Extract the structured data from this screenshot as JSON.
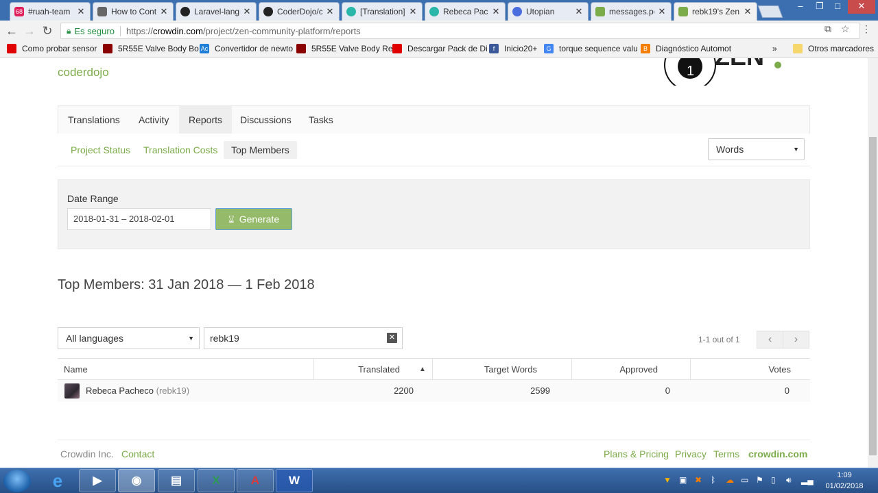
{
  "browser": {
    "tabs": [
      {
        "title": "#ruah-team",
        "fav_color": "#e01e5a",
        "fav_text": "68"
      },
      {
        "title": "How to Conti",
        "fav_color": "#666666",
        "fav_text": ""
      },
      {
        "title": "Laravel-lang",
        "fav_color": "#222222",
        "fav_text": ""
      },
      {
        "title": "CoderDojo/c",
        "fav_color": "#222222",
        "fav_text": ""
      },
      {
        "title": "[Translation]",
        "fav_color": "#2ab7a9",
        "fav_text": ""
      },
      {
        "title": "Rebeca Pach",
        "fav_color": "#2ab7a9",
        "fav_text": ""
      },
      {
        "title": "Utopian",
        "fav_color": "#4a6ee0",
        "fav_text": ""
      },
      {
        "title": "messages.po",
        "fav_color": "#7cab4a",
        "fav_text": ""
      },
      {
        "title": "rebk19's Zen",
        "fav_color": "#7cab4a",
        "fav_text": ""
      }
    ],
    "close_glyph": "✕",
    "security_label": "Es seguro",
    "url_prefix": "https://",
    "url_host": "crowdin.com",
    "url_path": "/project/zen-community-platform/reports",
    "bookmarks": [
      {
        "label": "Como probar sensor",
        "color": "#e00000"
      },
      {
        "label": "5R55E Valve Body Bo",
        "color": "#8b0000"
      },
      {
        "label": "Convertidor de newto",
        "color": "#1e7ed8"
      },
      {
        "label": "5R55E Valve Body Re",
        "color": "#8b0000"
      },
      {
        "label": "Descargar Pack de Di",
        "color": "#e00000"
      },
      {
        "label": "Inicio20+",
        "color": "#3b5998"
      },
      {
        "label": "torque sequence valu",
        "color": "#4285f4"
      },
      {
        "label": "Diagnóstico Automot",
        "color": "#f57d00"
      }
    ],
    "more_bookmarks": "»",
    "other_bookmarks": "Otros marcadores"
  },
  "page": {
    "org_name": "coderdojo",
    "logo_text": "ZEN",
    "logo_number": "1",
    "main_nav": [
      {
        "label": "Translations"
      },
      {
        "label": "Activity"
      },
      {
        "label": "Reports"
      },
      {
        "label": "Discussions"
      },
      {
        "label": "Tasks"
      }
    ],
    "active_main_nav": "Reports",
    "sub_nav": [
      {
        "label": "Project Status"
      },
      {
        "label": "Translation Costs"
      },
      {
        "label": "Top Members"
      }
    ],
    "active_sub_nav": "Top Members",
    "units_select": "Words",
    "date_range": {
      "label": "Date Range",
      "value": "2018-01-31 – 2018-02-01",
      "generate_label": "Generate"
    },
    "heading": "Top Members: 31 Jan 2018 — 1 Feb 2018",
    "filters": {
      "language": "All languages",
      "search_value": "rebk19"
    },
    "pagination": {
      "count_text": "1-1 out of 1",
      "prev": "‹",
      "next": "›"
    },
    "table": {
      "columns": [
        "Name",
        "Translated",
        "Target Words",
        "Approved",
        "Votes"
      ],
      "sort_indicator": "▲",
      "rows": [
        {
          "name": "Rebeca Pacheco",
          "login": "(rebk19)",
          "translated": "2200",
          "target_words": "2599",
          "approved": "0",
          "votes": "0"
        }
      ]
    },
    "footer": {
      "company": "Crowdin Inc.",
      "contact": "Contact",
      "plans": "Plans & Pricing",
      "privacy": "Privacy",
      "terms": "Terms",
      "brand": "crowdin.com"
    }
  },
  "taskbar": {
    "time": "1:09",
    "date": "01/02/2018"
  },
  "colors": {
    "accent_green": "#7cab4a",
    "button_green": "#95ba69",
    "taskbar_blue": "#264f86"
  }
}
